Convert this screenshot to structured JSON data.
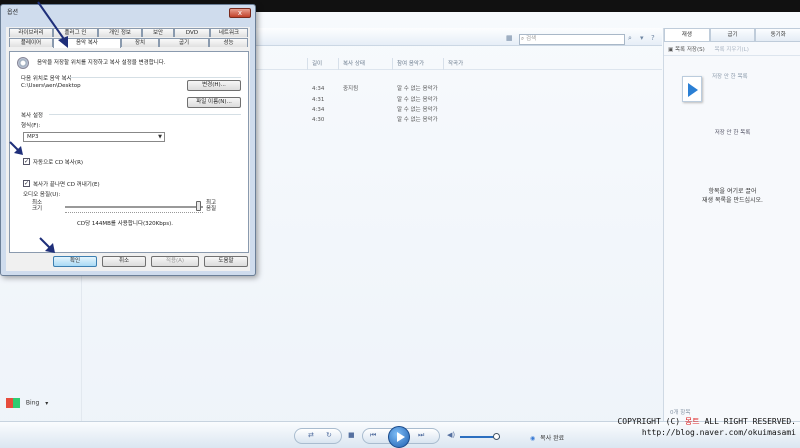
{
  "dialog": {
    "title": "옵션",
    "close_label": "x",
    "tabs_row1": [
      "라이브러리",
      "플러그 인",
      "개인 정보",
      "보안",
      "DVD",
      "네트워크"
    ],
    "tabs_row2": [
      "플레이어",
      "음악 복사",
      "장치",
      "굽기",
      "성능"
    ],
    "active_tab": "음악 복사",
    "description": "음악을 저장할 위치를 지정하고 복사 설정을 변경합니다.",
    "rip_location_label": "다음 위치로 음악 복사",
    "rip_path": "C:\\Users\\aen\\Desktop",
    "change_button": "변경(H)...",
    "filename_button": "파일 이름(N)...",
    "rip_settings_label": "복사 설정",
    "format_label": "형식(F):",
    "format_value": "MP3",
    "auto_rip_label": "자동으로 CD 복사(R)",
    "auto_rip_checked": true,
    "eject_label": "복사가 끝나면 CD 꺼내기(E)",
    "eject_checked": true,
    "audio_quality_label": "오디오 음질(U):",
    "min_size_label": "최소 크기",
    "best_quality_label": "최고 음질",
    "quality_fraction": 0.97,
    "usage_text": "CD당 144MB를 사용합니다(320Kbps).",
    "ok_button": "확인",
    "cancel_button": "취소",
    "apply_button": "적용(A)",
    "help_button": "도움말"
  },
  "player": {
    "search_placeholder": "검색",
    "columns": [
      "길이",
      "복사 상태",
      "참여 음악가",
      "작곡가"
    ],
    "tracks": [
      {
        "length": "4:34",
        "status": "중지됨",
        "artist": "알 수 없는 음악가"
      },
      {
        "length": "4:31",
        "status": "",
        "artist": "알 수 없는 음악가"
      },
      {
        "length": "4:34",
        "status": "",
        "artist": "알 수 없는 음악가"
      },
      {
        "length": "4:30",
        "status": "",
        "artist": "알 수 없는 음악가"
      }
    ],
    "nav_bing": "Bing",
    "status_text": "복사 완료"
  },
  "right_pane": {
    "tabs": [
      "재생",
      "굽기",
      "동기화"
    ],
    "save_list_button": "목록 저장(S)",
    "clear_list_button": "목록 지우기(L)",
    "unsaved_list_title": "저장 안 한 목록",
    "unsaved_list_heading": "저장 안 한 목록",
    "drag_hint_line1": "항목을 여기로 끌어",
    "drag_hint_line2": "재생 목록을 만드십시오.",
    "items_count": "0개 항목"
  },
  "watermark": {
    "line1_prefix": "COPYRIGHT (C)",
    "line1_name": "몽트",
    "line1_suffix": "ALL RIGHT RESERVED.",
    "line2": "http://blog.naver.com/okuimasami"
  },
  "colors": {
    "accent_blue": "#1e5fb0",
    "dialog_frame": "#cfdced",
    "close_red": "#c2412a"
  }
}
